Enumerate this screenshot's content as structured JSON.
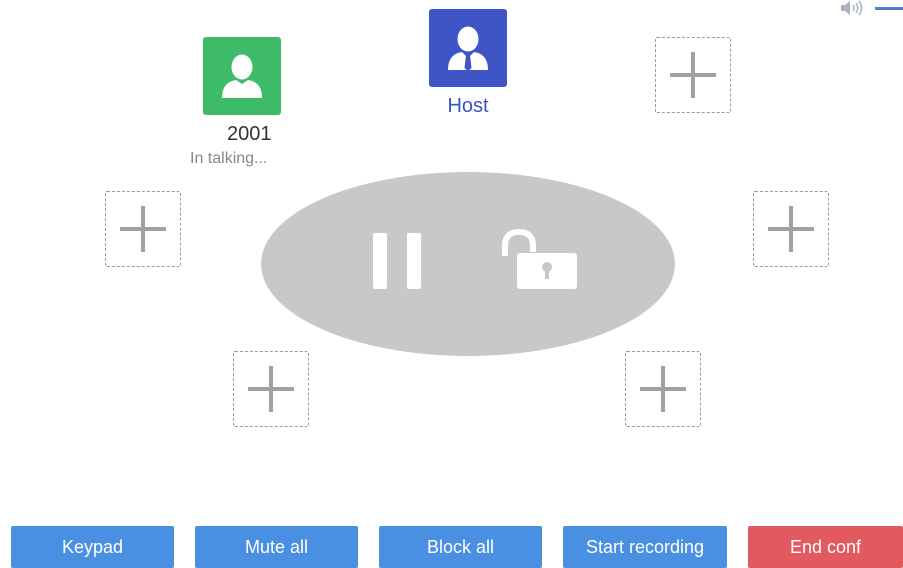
{
  "volume": {
    "icon": "speaker-icon"
  },
  "members": {
    "host": {
      "name": "Host",
      "icon": "user-tie-icon",
      "color": "#3f55c6"
    },
    "ext2001": {
      "name": "2001",
      "status": "In talking...",
      "icon": "user-icon",
      "color": "#3dbb68"
    }
  },
  "controls": {
    "pause_icon": "pause-icon",
    "lock_icon": "unlock-icon",
    "add_icon": "plus-icon"
  },
  "toolbar": {
    "keypad_label": "Keypad",
    "mute_all_label": "Mute all",
    "block_all_label": "Block all",
    "start_recording_label": "Start recording",
    "end_conf_label": "End conf"
  },
  "colors": {
    "accent": "#4a90e2",
    "danger": "#e25a60",
    "host": "#3f55c6",
    "member": "#3dbb68"
  }
}
